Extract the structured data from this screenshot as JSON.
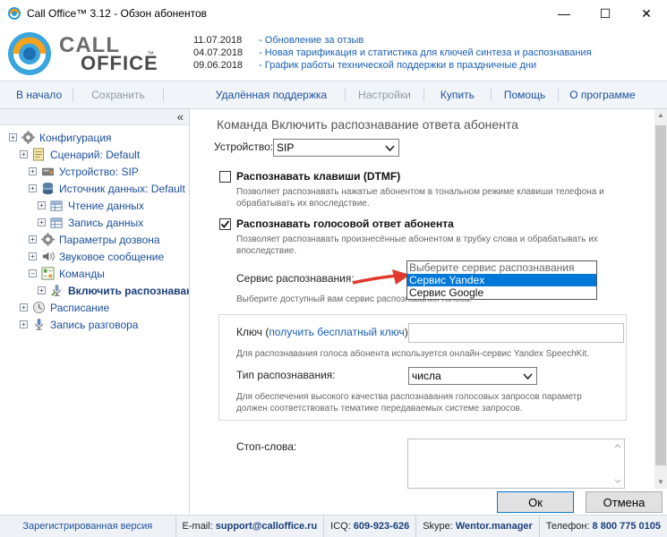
{
  "window": {
    "title": "Call Office™ 3.12 - Обзон абонентов",
    "minimize": "—",
    "maximize": "☐",
    "close": "✕"
  },
  "logo": {
    "line1": "CALL",
    "line2": "OFFICE",
    "tm": "™"
  },
  "news": [
    {
      "date": "11.07.2018",
      "text": "- Обновление за отзыв"
    },
    {
      "date": "04.07.2018",
      "text": "- Новая тарификация и статистика для ключей синтеза и распознавания"
    },
    {
      "date": "09.06.2018",
      "text": "- График работы технической поддержки в праздничные дни"
    }
  ],
  "toolbar": {
    "home": "В начало",
    "save": "Сохранить",
    "remote": "Удалённая поддержка",
    "settings": "Настройки",
    "buy": "Купить",
    "help": "Помощь",
    "about": "О программе"
  },
  "tree": {
    "collapse": "«",
    "items": [
      {
        "label": "Конфигурация",
        "icon": "gear-icon"
      },
      {
        "label": "Сценарий: Default",
        "icon": "document-icon"
      },
      {
        "label": "Устройство: SIP",
        "icon": "device-icon"
      },
      {
        "label": "Источник данных: Default",
        "icon": "database-icon"
      },
      {
        "label": "Чтение данных",
        "icon": "table-icon"
      },
      {
        "label": "Запись данных",
        "icon": "table-icon"
      },
      {
        "label": "Параметры дозвона",
        "icon": "gear-icon"
      },
      {
        "label": "Звуковое сообщение",
        "icon": "speaker-icon"
      },
      {
        "label": "Команды",
        "icon": "commands-icon"
      },
      {
        "label": "Включить распознаван",
        "icon": "microphone-icon"
      },
      {
        "label": "Расписание",
        "icon": "clock-icon"
      },
      {
        "label": "Запись разговора",
        "icon": "microphone-icon"
      }
    ]
  },
  "main": {
    "title": "Команда Включить распознавание ответа абонента",
    "device_label": "Устройство:",
    "device_value": "SIP",
    "dtmf_title": "Распознавать клавиши (DTMF)",
    "dtmf_hint1": "Позволяет распознавать нажатые абонентом в тональном режиме клавиши телефона и",
    "dtmf_hint2": "обрабатывать их впоследствие.",
    "voice_title": "Распознавать голосовой ответ абонента",
    "voice_hint1": "Позволяет распознавать произнесённые абонентом в трубку слова и обрабатывать их",
    "voice_hint2": "впоследствие.",
    "service_label": "Сервис распознавания:",
    "service_hint": "Выберите доступный вам сервис распознавания голоса.",
    "dropdown": {
      "placeholder": "Выберите сервис распознавания",
      "options": [
        "Сервис Yandex",
        "Сервис Google"
      ]
    },
    "key_label": "Ключ (",
    "key_link": "получить бесплатный ключ",
    "key_label_end": "):",
    "key_hint": "Для распознавания голоса абонента используется онлайн-сервис Yandex SpeechKit.",
    "type_label": "Тип распознавания:",
    "type_value": "числа",
    "type_hint1": "Для обеспечения высокого качества распознавания голосовых запросов параметр",
    "type_hint2": "должен соответствовать тематике передаваемых системе запросов.",
    "stopwords_label": "Стоп-слова:"
  },
  "buttons": {
    "ok": "Ок",
    "cancel": "Отмена"
  },
  "status": {
    "registered": "Зарегистрированная версия",
    "email_label": "E-mail:",
    "email": "support@calloffice.ru",
    "icq_label": "ICQ:",
    "icq": "609-923-626",
    "skype_label": "Skype:",
    "skype": "Wentor.manager",
    "phone_label": "Телефон:",
    "phone": "8 800 775 0105"
  },
  "colors": {
    "accent": "#1c4f9c",
    "selection": "#0078d7",
    "arrow": "#e03a2f"
  }
}
